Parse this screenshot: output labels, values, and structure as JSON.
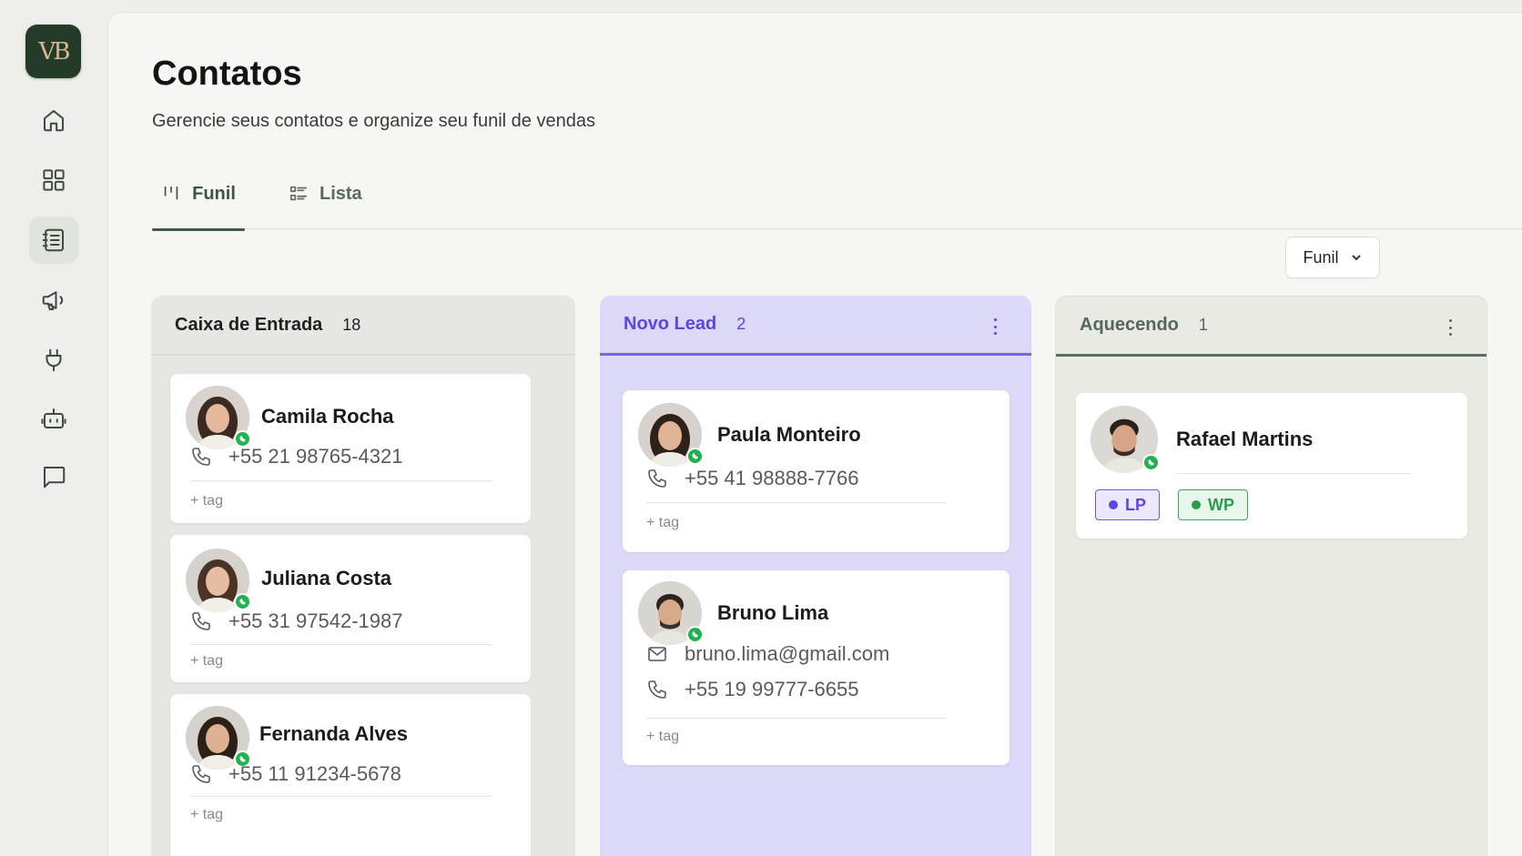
{
  "app": {
    "logo_text": "VB"
  },
  "sidebar": {
    "items": [
      {
        "icon": "home-icon"
      },
      {
        "icon": "dashboard-grid-icon"
      },
      {
        "icon": "contacts-book-icon",
        "active": true
      },
      {
        "icon": "megaphone-icon"
      },
      {
        "icon": "plug-icon"
      },
      {
        "icon": "bot-icon"
      },
      {
        "icon": "chat-bubble-icon"
      }
    ]
  },
  "header": {
    "title": "Contatos",
    "subtitle": "Gerencie seus contatos e organize seu funil de vendas"
  },
  "tabs": [
    {
      "label": "Funil",
      "icon": "kanban-icon",
      "active": true
    },
    {
      "label": "Lista",
      "icon": "list-icon",
      "active": false
    }
  ],
  "view_select": {
    "value": "Funil"
  },
  "columns": [
    {
      "title": "Caixa de Entrada",
      "count": "18",
      "cards": [
        {
          "name": "Camila Rocha",
          "phone": "+55 21 98765-4321",
          "add_tag": "+ tag"
        },
        {
          "name": "Juliana Costa",
          "phone": "+55 31 97542-1987",
          "add_tag": "+ tag"
        },
        {
          "name": "Fernanda Alves",
          "phone": "+55 11 91234-5678",
          "add_tag": "+ tag"
        }
      ]
    },
    {
      "title": "Novo Lead",
      "count": "2",
      "accent": "#5b45e3",
      "cards": [
        {
          "name": "Paula Monteiro",
          "phone": "+55 41 98888-7766",
          "add_tag": "+ tag"
        },
        {
          "name": "Bruno Lima",
          "email": "bruno.lima@gmail.com",
          "phone": "+55 19 99777-6655",
          "add_tag": "+ tag"
        }
      ]
    },
    {
      "title": "Aquecendo",
      "count": "1",
      "accent": "#55675a",
      "cards": [
        {
          "name": "Rafael Martins",
          "tags": [
            "LP",
            "WP"
          ]
        }
      ]
    }
  ],
  "colors": {
    "brand": "#233b27",
    "whatsapp": "#1fb24e",
    "lp_tag": "#5b45e3",
    "wp_tag": "#2c9c50"
  }
}
